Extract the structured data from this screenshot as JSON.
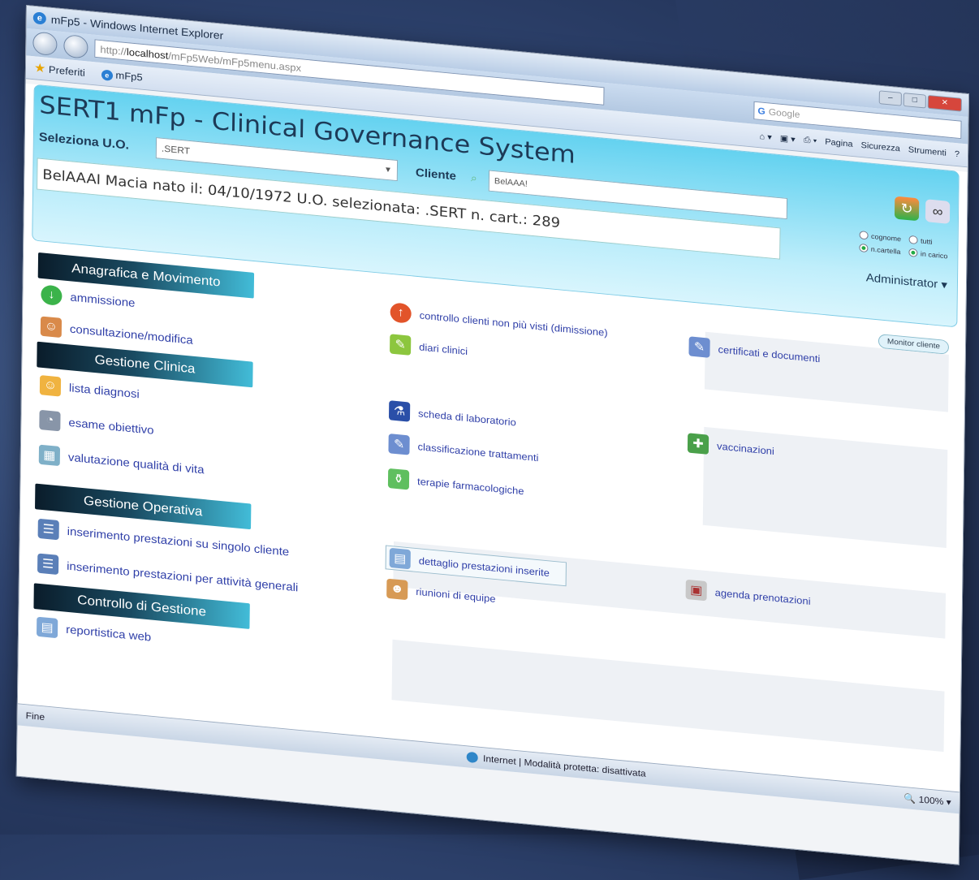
{
  "window": {
    "title": "mFp5 - Windows Internet Explorer",
    "icon": "ie-icon"
  },
  "address": {
    "prefix": "http://",
    "host": "localhost",
    "path": "/mFp5Web/mFp5menu.aspx"
  },
  "search_box": {
    "placeholder": "Google"
  },
  "favorites": {
    "label": "Preferiti",
    "tab_label": "mFp5"
  },
  "commandbar": {
    "pagina": "Pagina",
    "sicurezza": "Sicurezza",
    "strumenti": "Strumenti"
  },
  "header": {
    "title": "SERT1 mFp - Clinical Governance System",
    "uo_label": "Seleziona U.O.",
    "uo_value": ".SERT",
    "cliente_label": "Cliente",
    "cliente_value": "BelAAA!",
    "patient_info": "BelAAAI Macia nato il: 04/10/1972 U.O. selezionata: .SERT n. cart.: 289",
    "radios": [
      {
        "label": "cognome",
        "selected": false
      },
      {
        "label": "tutti",
        "selected": false
      },
      {
        "label": "n.cartella",
        "selected": true
      },
      {
        "label": "in carico",
        "selected": true
      }
    ],
    "user": "Administrator",
    "monitor": "Monitor cliente"
  },
  "sections": {
    "anagrafica": "Anagrafica e Movimento",
    "clinica": "Gestione Clinica",
    "operativa": "Gestione Operativa",
    "controllo": "Controllo di Gestione"
  },
  "items": {
    "ammissione": "ammissione",
    "consultazione": "consultazione/modifica",
    "controllo_clienti": "controllo clienti non più visti (dimissione)",
    "certificati": "certificati e documenti",
    "diari": "diari clinici",
    "lista_diagnosi": "lista diagnosi",
    "scheda_lab": "scheda di laboratorio",
    "vaccinazioni": "vaccinazioni",
    "esame": "esame obiettivo",
    "classificazione": "classificazione trattamenti",
    "valutazione": "valutazione qualità di vita",
    "terapie": "terapie farmacologiche",
    "ins_singolo": "inserimento prestazioni su singolo cliente",
    "dettaglio": "dettaglio prestazioni inserite",
    "agenda": "agenda prenotazioni",
    "ins_generali": "inserimento prestazioni per attività generali",
    "riunioni": "riunioni di equipe",
    "reportistica": "reportistica web"
  },
  "status": {
    "left": "Fine",
    "zone": "Internet | Modalità protetta: disattivata",
    "zoom": "100%"
  }
}
